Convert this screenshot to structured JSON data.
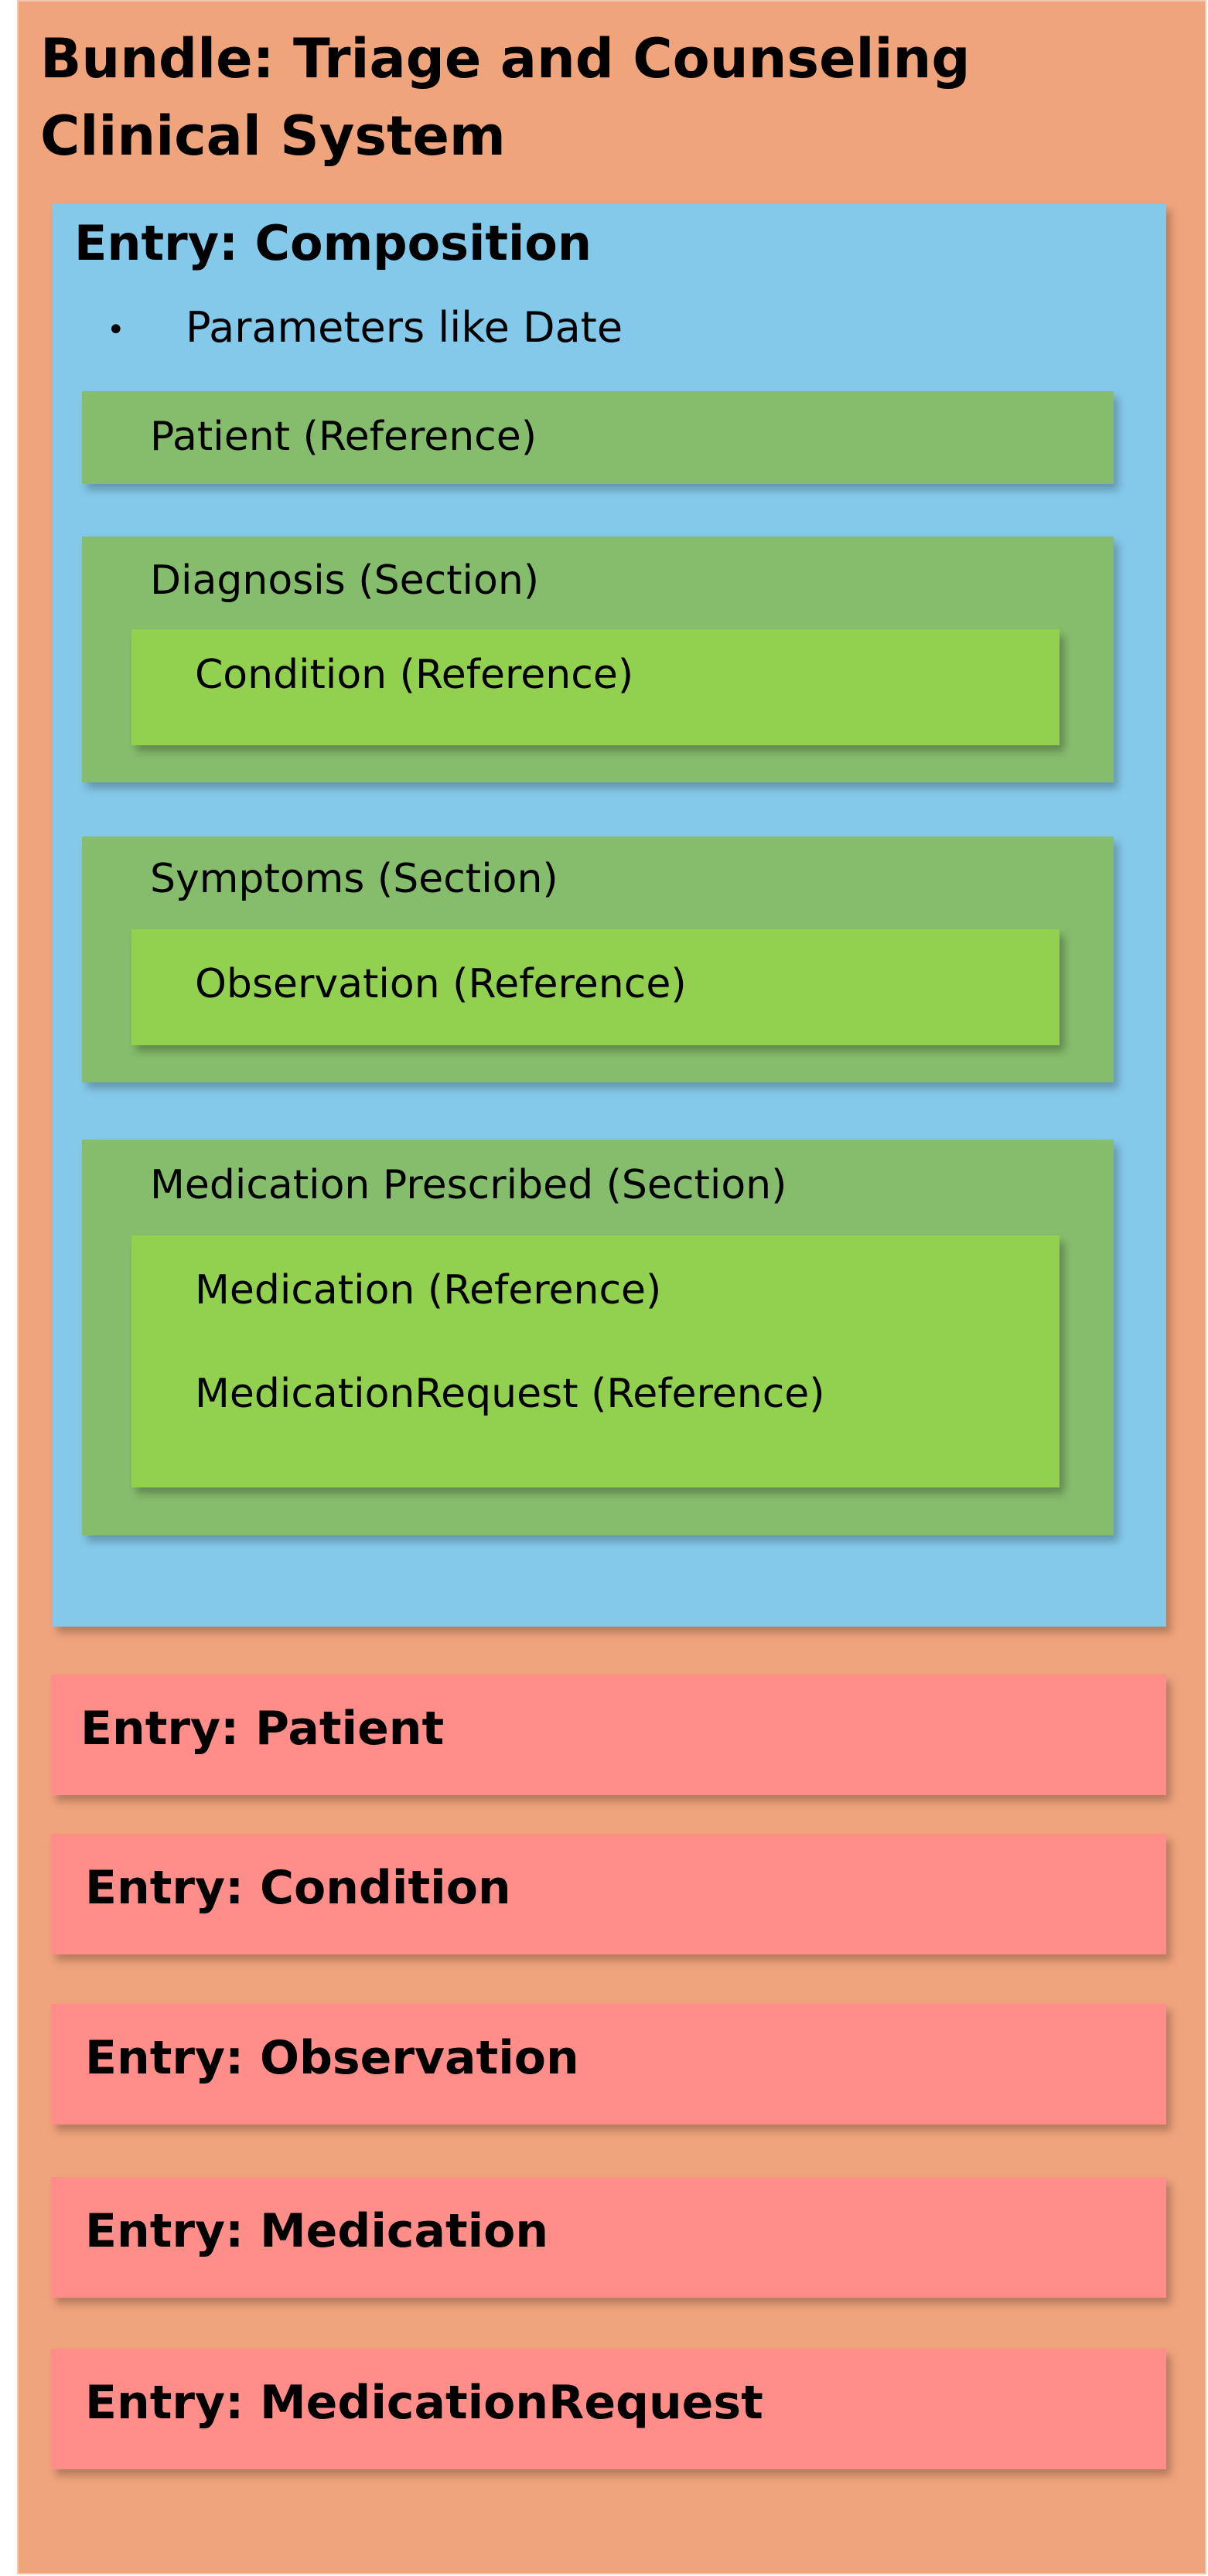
{
  "bundle": {
    "title": "Bundle: Triage and Counseling Clinical System"
  },
  "composition": {
    "title": "Entry: Composition",
    "bullet": "Parameters like Date",
    "patient_ref": "Patient (Reference)",
    "sections": [
      {
        "title": "Diagnosis (Section)",
        "refs": [
          "Condition (Reference)"
        ]
      },
      {
        "title": "Symptoms (Section)",
        "refs": [
          "Observation (Reference)"
        ]
      },
      {
        "title": "Medication Prescribed (Section)",
        "refs": [
          "Medication (Reference)",
          "MedicationRequest (Reference)"
        ]
      }
    ]
  },
  "entries": [
    "Entry: Patient",
    "Entry: Condition",
    "Entry: Observation",
    "Entry: Medication",
    "Entry: MedicationRequest"
  ],
  "colors": {
    "bundle": "#F0A47C",
    "composition": "#85C9EA",
    "section": "#86BD6D",
    "reference": "#92D050",
    "entry": "#FF8E8A"
  }
}
